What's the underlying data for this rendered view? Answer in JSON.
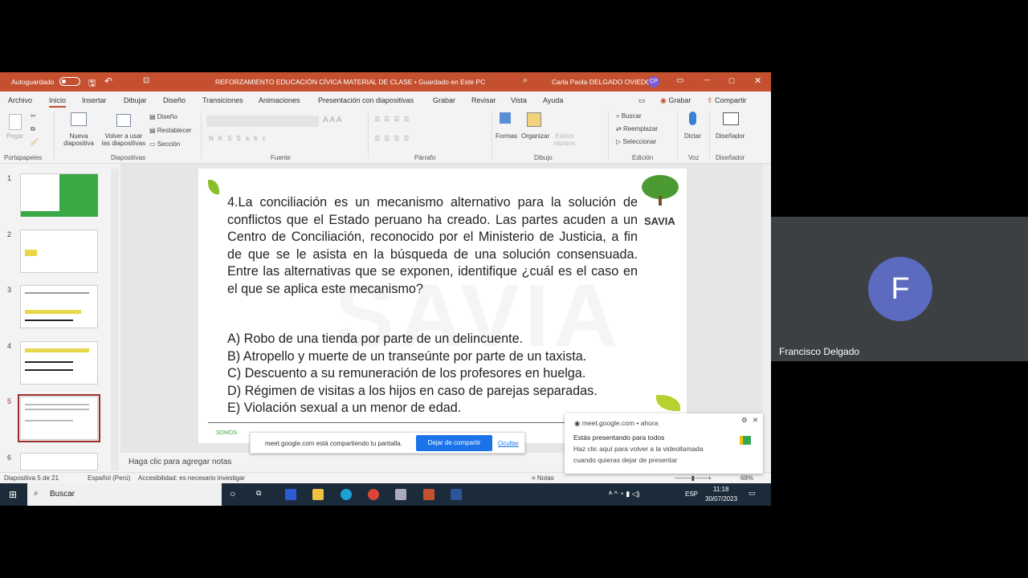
{
  "window": {
    "autosave_label": "Autoguardado",
    "title": "REFORZAMIENTO EDUCACIÓN CÍVICA MATERIAL DE CLASE • Guardado en Este PC",
    "user_name": "Carla Paola DELGADO OVIEDO",
    "user_initials": "CP"
  },
  "menu": {
    "tabs": [
      "Archivo",
      "Inicio",
      "Insertar",
      "Dibujar",
      "Diseño",
      "Transiciones",
      "Animaciones",
      "Presentación con diapositivas",
      "Grabar",
      "Revisar",
      "Vista",
      "Ayuda"
    ],
    "active": "Inicio",
    "record": "Grabar",
    "share": "Compartir"
  },
  "ribbon": {
    "paste": "Pegar",
    "new_slide": "Nueva diapositiva",
    "reuse": "Volver a usar las diapositivas",
    "layout": "Diseño",
    "reset": "Restablecer",
    "section": "Sección",
    "shapes": "Formas",
    "arrange": "Organizar",
    "quick_styles": "Estilos rápidos",
    "find": "Buscar",
    "replace": "Reemplazar",
    "select": "Seleccionar",
    "dictate": "Dictar",
    "designer": "Diseñador",
    "groups": [
      "Portapapeles",
      "Diapositivas",
      "Fuente",
      "Párrafo",
      "Dibujo",
      "Edición",
      "Voz",
      "Diseñador"
    ]
  },
  "thumbnails": [
    "1",
    "2",
    "3",
    "4",
    "5",
    "6"
  ],
  "selected_slide": "5",
  "slide": {
    "question": "4.La conciliación es un mecanismo alternativo para la solución de conflictos que el Estado peruano ha creado. Las partes acuden a un Centro de Conciliación, reconocido por el Ministerio de Justicia, a fin de que se le asista en la búsqueda de una solución consensuada. Entre las alternativas que se exponen, identifique ¿cuál es el caso en el que se aplica este mecanismo?",
    "options": [
      "A) Robo de una tienda por parte de un delincuente.",
      "B) Atropello y muerte de un transeúnte por parte de un taxista.",
      "C) Descuento a su remuneración de los profesores en huelga.",
      "D) Régimen de visitas a los hijos en caso de parejas separadas.",
      "E) Violación sexual a un menor de edad."
    ],
    "logo": "SAVIA",
    "footer": "SOMOS"
  },
  "notes_placeholder": "Haga clic para agregar notas",
  "status": {
    "slide": "Diapositiva 5 de 21",
    "language": "Español (Perú)",
    "accessibility": "Accesibilidad: es necesario investigar",
    "notes": "Notas",
    "zoom": "68%"
  },
  "share_bar": {
    "text": "meet.google.com está compartiendo tu pantalla.",
    "stop": "Dejar de compartir",
    "hide": "Ocultar"
  },
  "notification": {
    "source": "meet.google.com",
    "time": "ahora",
    "title": "Estás presentando para todos",
    "body1": "Haz clic aquí para volver a la videollamada",
    "body2": "cuando quieras dejar de presentar"
  },
  "taskbar": {
    "search": "Buscar",
    "lang": "ESP",
    "time": "11:18",
    "date": "30/07/2023"
  },
  "participant": {
    "initial": "F",
    "name": "Francisco Delgado",
    "avatar_color": "#5c6bc0"
  }
}
